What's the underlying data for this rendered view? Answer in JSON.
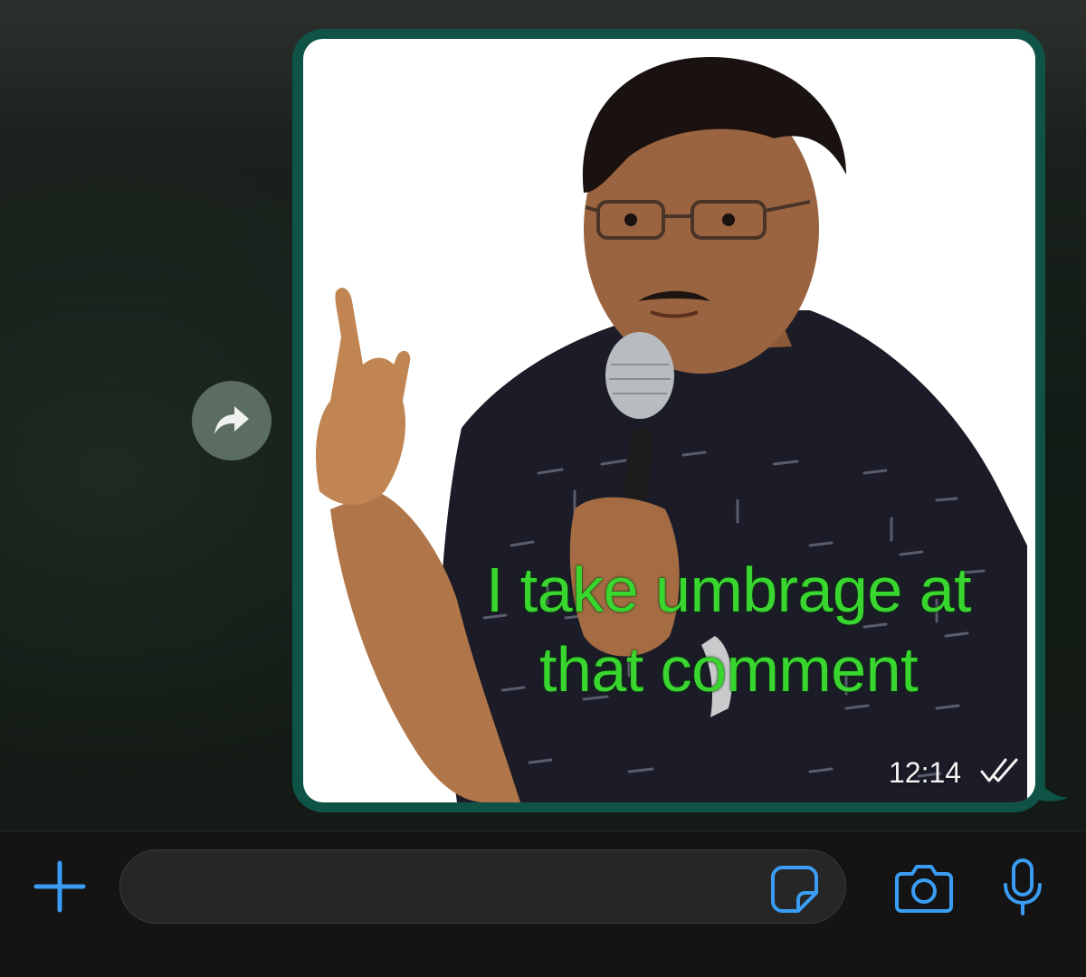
{
  "message": {
    "sticker_caption_line1": "I take umbrage at",
    "sticker_caption_line2": "that comment",
    "time": "12:14",
    "status_icon": "double-check-icon"
  },
  "actions": {
    "forward_icon": "forward-arrow-icon"
  },
  "composer": {
    "message_value": "",
    "icons": [
      "plus-icon",
      "sticker-icon",
      "camera-icon",
      "microphone-icon"
    ]
  },
  "colors": {
    "bubble": "#0f5347",
    "accent_blue": "#3a9cf2",
    "caption_green": "#39d62f",
    "forward_button": "#5b6d60"
  }
}
